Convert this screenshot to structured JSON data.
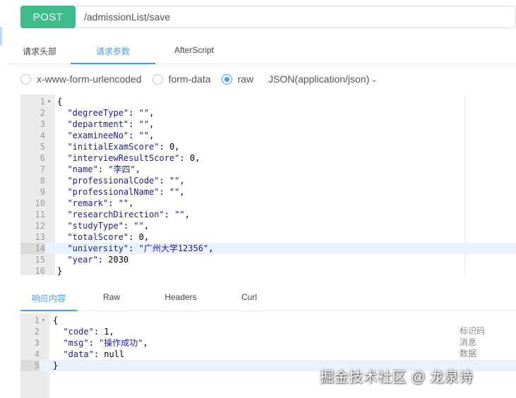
{
  "request": {
    "method": "POST",
    "url": "/admissionList/save"
  },
  "request_tabs": [
    {
      "label": "请求头部",
      "active": false
    },
    {
      "label": "请求参数",
      "active": true
    },
    {
      "label": "AfterScript",
      "active": false
    }
  ],
  "body_types": [
    {
      "label": "x-www-form-urlencoded",
      "checked": false
    },
    {
      "label": "form-data",
      "checked": false
    },
    {
      "label": "raw",
      "checked": true
    }
  ],
  "content_type": "JSON(application/json)",
  "request_body": {
    "highlighted_line": 14,
    "lines": [
      "{",
      "  \"degreeType\": \"\",",
      "  \"department\": \"\",",
      "  \"examineeNo\": \"\",",
      "  \"initialExamScore\": 0,",
      "  \"interviewResultScore\": 0,",
      "  \"name\": \"李四\",",
      "  \"professionalCode\": \"\",",
      "  \"professionalName\": \"\",",
      "  \"remark\": \"\",",
      "  \"researchDirection\": \"\",",
      "  \"studyType\": \"\",",
      "  \"totalScore\": 0,",
      "  \"university\": \"广州大学12356\",",
      "  \"year\": 2030",
      "}"
    ]
  },
  "response_tabs": [
    {
      "label": "响应内容",
      "active": true
    },
    {
      "label": "Raw",
      "active": false
    },
    {
      "label": "Headers",
      "active": false
    },
    {
      "label": "Curl",
      "active": false
    }
  ],
  "response_body": {
    "highlighted_line": 5,
    "lines": [
      "{",
      "  \"code\": 1,",
      "  \"msg\": \"操作成功\",",
      "  \"data\": null",
      "}"
    ]
  },
  "field_annotations": [
    "标识码",
    "消息",
    "数据"
  ],
  "watermark": "掘金技术社区 @ 龙泉诗",
  "colors": {
    "method_button": "#3ebd8c",
    "accent": "#409eff",
    "gutter": "#ebebeb",
    "active_line": "#e8f2fe"
  }
}
